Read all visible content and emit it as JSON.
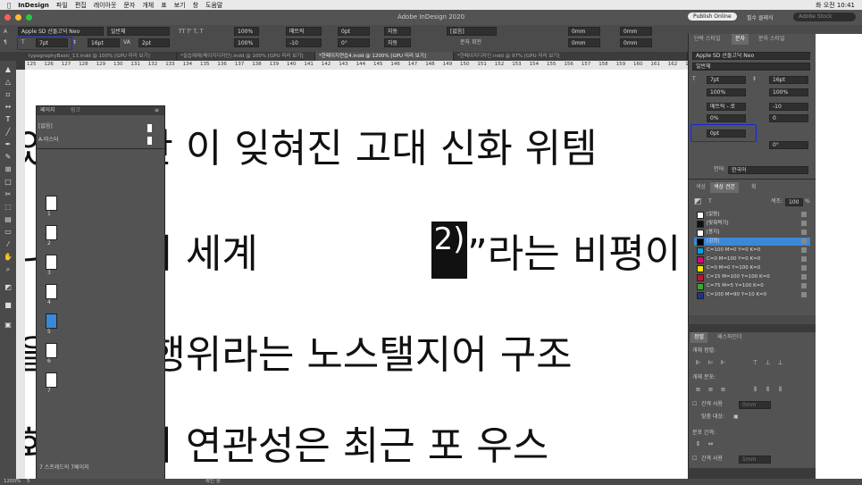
{
  "menubar": {
    "items": [
      "InDesign",
      "파일",
      "편집",
      "레이아웃",
      "문자",
      "개체",
      "표",
      "보기",
      "창",
      "도움말"
    ],
    "clock": "화 오전 10:41"
  },
  "window": {
    "title": "Adobe InDesign 2020",
    "publish_label": "Publish Online",
    "workspace": "필수 클래식",
    "stock_placeholder": "Adobe Stock"
  },
  "control": {
    "font_family": "Apple SD 산돌고딕 Neo",
    "font_style": "일반체",
    "font_size": "7pt",
    "leading": "16pt",
    "tracking": "2pt",
    "scale_h": "100%",
    "scale_v": "100%",
    "kerning": "메트릭",
    "tracking2": "-10",
    "baseline": "0pt",
    "skew": "0°",
    "rotation": "0°",
    "style_none": "[없음]",
    "char_rotate": "문자 회전",
    "auto1": "자동",
    "auto2": "자동",
    "mm1": "0mm",
    "mm2": "0mm",
    "mm3": "0mm",
    "mm4": "0mm",
    "tt_icons": "TT T' T, T"
  },
  "tabs": [
    "typographyBasic_13.indd @ 100% [GPU 미리 보기]",
    "*실습예제(페이지디자인).indd @ 100% [GPU 미리 보기]",
    "*한페이지연습4.indd @ 1200% [GPU 미리 보기]",
    "*한페이지디자인.indd @ 97% [GPU 미리 보기]"
  ],
  "ruler": [
    "125",
    "126",
    "127",
    "128",
    "129",
    "130",
    "131",
    "132",
    "133",
    "134",
    "135",
    "136",
    "137",
    "138",
    "139",
    "140",
    "141",
    "142",
    "143",
    "144",
    "145",
    "146",
    "147",
    "148",
    "149",
    "150",
    "151",
    "152",
    "153",
    "154",
    "155",
    "156",
    "157",
    "158",
    "159",
    "160",
    "161",
    "162",
    "163"
  ],
  "canvas": {
    "line1": "있 하지만 이 잊혀진 고대 신화 위템",
    "line2": "나 이미지 세계",
    "line2b": "”라는 비평이 바라",
    "line2_highlight": "2)",
    "line3": "을 예술 행위라는 노스탤지어 구조",
    "line4": "화 신화의 연관성은 최근 포 우스"
  },
  "pages_panel": {
    "tabs": [
      "페이지",
      "링크"
    ],
    "none_master": "[없음]",
    "a_master": "A-마스터",
    "pages": [
      "1",
      "2",
      "3",
      "4",
      "5",
      "6",
      "7"
    ],
    "selected_page": "5",
    "footer": "7 스프레드의 7페이지"
  },
  "status": {
    "zoom": "1200%",
    "page": "5",
    "preflight": "확인 중"
  },
  "char_panel": {
    "tabs": [
      "단락 스타일",
      "문자",
      "문자 스타일"
    ],
    "font_family": "Apple SD 산돌고딕 Neo",
    "font_style": "일반체",
    "size": "7pt",
    "leading": "16pt",
    "scale_v": "100%",
    "scale_h": "100%",
    "kerning": "메트릭 - 로",
    "tracking": "-10",
    "tsume": "0%",
    "baseline": "0",
    "baseline_shift": "0pt",
    "skew": "0°",
    "language_label": "언어:",
    "language": "한국어"
  },
  "swatch_panel": {
    "tabs": [
      "색상",
      "색상 견본",
      "획"
    ],
    "tint_label": "색조:",
    "tint": "100",
    "tint_unit": "%",
    "swatches": [
      {
        "name": "[없음]",
        "color": "#ffffff"
      },
      {
        "name": "[맞춰찍기]",
        "color": "#111111"
      },
      {
        "name": "[용지]",
        "color": "#ffffff"
      },
      {
        "name": "[검정]",
        "color": "#000000"
      },
      {
        "name": "C=100 M=0 Y=0 K=0",
        "color": "#00a0e0"
      },
      {
        "name": "C=0 M=100 Y=0 K=0",
        "color": "#e0007a"
      },
      {
        "name": "C=0 M=0 Y=100 K=0",
        "color": "#f5e600"
      },
      {
        "name": "C=15 M=100 Y=100 K=0",
        "color": "#c8102e"
      },
      {
        "name": "C=75 M=5 Y=100 K=0",
        "color": "#3fa535"
      },
      {
        "name": "C=100 M=90 Y=10 K=0",
        "color": "#22338c"
      }
    ],
    "selected_index": 3
  },
  "align_panel": {
    "tabs": [
      "정렬",
      "패스파인더"
    ],
    "align_objects": "개체 정렬:",
    "distribute_objects": "개체 분포:",
    "use_spacing": "간격 사용",
    "spacing_value": "0mm",
    "align_to": "맞춤 대상:",
    "distribute_spacing": "분포 간격:",
    "use_spacing2": "간격 사용",
    "spacing_value2": "1mm"
  },
  "colors": {
    "annotation": "#1428e0",
    "selected_page": "#3c88d8"
  }
}
